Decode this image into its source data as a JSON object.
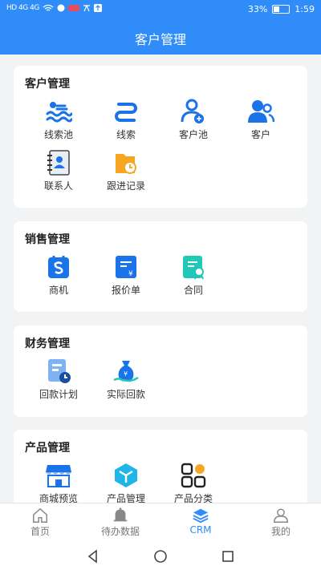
{
  "status_bar": {
    "left_text": "HD 4G 4G",
    "battery": "33%",
    "time": "1:59"
  },
  "header": {
    "title": "客户管理"
  },
  "sections": [
    {
      "title": "客户管理",
      "items": [
        {
          "label": "线索池",
          "icon": "clue-pool-icon"
        },
        {
          "label": "线索",
          "icon": "clue-icon"
        },
        {
          "label": "客户池",
          "icon": "customer-pool-icon"
        },
        {
          "label": "客户",
          "icon": "customer-icon"
        },
        {
          "label": "联系人",
          "icon": "contacts-icon"
        },
        {
          "label": "跟进记录",
          "icon": "follow-up-record-icon"
        }
      ]
    },
    {
      "title": "销售管理",
      "items": [
        {
          "label": "商机",
          "icon": "opportunity-icon"
        },
        {
          "label": "报价单",
          "icon": "quotation-icon"
        },
        {
          "label": "合同",
          "icon": "contract-icon"
        }
      ]
    },
    {
      "title": "财务管理",
      "items": [
        {
          "label": "回款计划",
          "icon": "payment-plan-icon"
        },
        {
          "label": "实际回款",
          "icon": "actual-payment-icon"
        }
      ]
    },
    {
      "title": "产品管理",
      "items": [
        {
          "label": "商城预览",
          "icon": "store-preview-icon"
        },
        {
          "label": "产品管理",
          "icon": "product-management-icon"
        },
        {
          "label": "产品分类",
          "icon": "product-category-icon"
        }
      ]
    }
  ],
  "tabbar": [
    {
      "label": "首页",
      "icon": "home-icon"
    },
    {
      "label": "待办数据",
      "icon": "bell-icon"
    },
    {
      "label": "CRM",
      "icon": "crm-layers-icon",
      "active": true
    },
    {
      "label": "我的",
      "icon": "user-icon"
    }
  ],
  "colors": {
    "primary": "#2f8cf8",
    "orange": "#f6a623",
    "green": "#1fc8b7"
  }
}
